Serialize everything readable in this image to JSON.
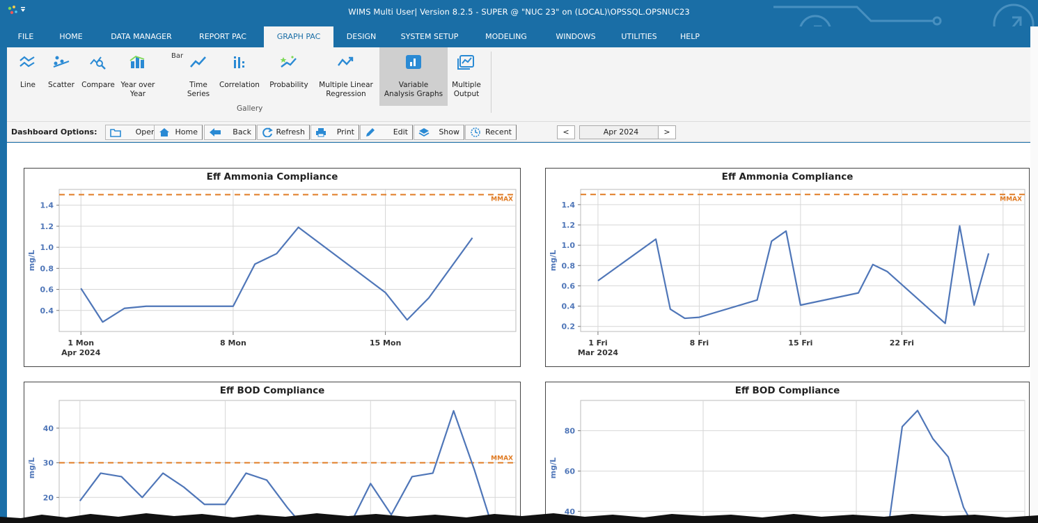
{
  "window": {
    "title": "WIMS Multi User| Version 8.2.5 - SUPER @ \"NUC 23\" on (LOCAL)\\OPSSQL.OPSNUC23"
  },
  "menu": {
    "items": [
      "FILE",
      "HOME",
      "DATA MANAGER",
      "REPORT PAC",
      "GRAPH PAC",
      "DESIGN",
      "SYSTEM SETUP",
      "MODELING",
      "WINDOWS",
      "UTILITIES",
      "HELP"
    ],
    "active": "GRAPH PAC"
  },
  "ribbon": {
    "buttons": [
      {
        "label": "Line",
        "icon": "line-chart-icon"
      },
      {
        "label": "Scatter",
        "icon": "scatter-chart-icon"
      },
      {
        "label": "Compare",
        "icon": "compare-chart-icon"
      },
      {
        "label": "Year over\nYear",
        "icon": "bar-chart-icon"
      },
      {
        "label": "Time\nSeries",
        "icon": "time-series-icon"
      },
      {
        "label": "Correlation",
        "icon": "correlation-icon"
      },
      {
        "label": "Probability",
        "icon": "probability-icon"
      },
      {
        "label": "Multiple Linear\nRegression",
        "icon": "regression-icon"
      },
      {
        "label": "Variable\nAnalysis Graphs",
        "icon": "variable-analysis-icon"
      },
      {
        "label": "Multiple\nOutput",
        "icon": "multiple-output-icon"
      }
    ],
    "bar_label": "Bar",
    "group_label": "Gallery",
    "selected": "Variable\nAnalysis Graphs"
  },
  "dashboard": {
    "label": "Dashboard Options:",
    "buttons": [
      "Open",
      "Home",
      "Back",
      "Refresh",
      "Print",
      "Edit",
      "Show",
      "Recent"
    ],
    "prev": "<",
    "next": ">",
    "month": "Apr 2024"
  },
  "colors": {
    "accent": "#1a6ea6",
    "series": "#4f76b8",
    "mmax": "#e07b23"
  },
  "chart_data": [
    {
      "type": "line",
      "title": "Eff Ammonia Compliance",
      "ylabel": "mg/L",
      "xlabel": "",
      "date_label": "Apr 2024",
      "x_ticks": [
        "1 Mon",
        "8 Mon",
        "15 Mon"
      ],
      "x": [
        1,
        2,
        3,
        4,
        5,
        6,
        7,
        8,
        9,
        10,
        11,
        15,
        16,
        17,
        19
      ],
      "values": [
        0.61,
        0.29,
        0.42,
        0.44,
        0.44,
        0.44,
        0.44,
        0.44,
        0.84,
        0.94,
        1.19,
        0.57,
        0.31,
        0.52,
        1.09
      ],
      "ylim": [
        0.2,
        1.55
      ],
      "y_ticks": [
        0.4,
        0.6,
        0.8,
        1.0,
        1.2,
        1.4
      ],
      "limit": {
        "label": "MMAX",
        "value": 1.5
      }
    },
    {
      "type": "line",
      "title": "Eff Ammonia Compliance",
      "ylabel": "mg/L",
      "xlabel": "",
      "date_label": "Mar 2024",
      "x_ticks": [
        "1 Fri",
        "8 Fri",
        "15 Fri",
        "22 Fri"
      ],
      "x": [
        1,
        5,
        6,
        7,
        8,
        12,
        13,
        14,
        15,
        19,
        20,
        21,
        25,
        26,
        27,
        28
      ],
      "values": [
        0.65,
        1.06,
        0.37,
        0.28,
        0.29,
        0.46,
        1.04,
        1.14,
        0.41,
        0.53,
        0.81,
        0.74,
        0.23,
        1.19,
        0.41,
        0.92
      ],
      "ylim": [
        0.15,
        1.55
      ],
      "y_ticks": [
        0.2,
        0.4,
        0.6,
        0.8,
        1.0,
        1.2,
        1.4
      ],
      "limit": {
        "label": "MMAX",
        "value": 1.5
      }
    },
    {
      "type": "line",
      "title": "Eff BOD Compliance",
      "ylabel": "mg/L",
      "xlabel": "",
      "x": [
        1,
        2,
        3,
        4,
        5,
        6,
        7,
        8,
        9,
        10,
        11,
        12,
        13,
        14,
        15,
        16,
        17,
        18,
        19,
        20,
        21
      ],
      "values": [
        19,
        27,
        26,
        20,
        27,
        23,
        18,
        18,
        27,
        25,
        17,
        10,
        8,
        12,
        24,
        15,
        26,
        27,
        45,
        28,
        9
      ],
      "ylim": [
        9,
        48
      ],
      "y_ticks": [
        10,
        20,
        30,
        40
      ],
      "limit": {
        "label": "MMAX",
        "value": 30
      }
    },
    {
      "type": "line",
      "title": "Eff BOD Compliance",
      "ylabel": "mg/L",
      "xlabel": "",
      "x": [
        1,
        2,
        3,
        4,
        5,
        6,
        7,
        8,
        9,
        10,
        11,
        12,
        13,
        14,
        15,
        16,
        17,
        18,
        19,
        20,
        21,
        22,
        23,
        24,
        25,
        26,
        27,
        28
      ],
      "values": [
        24,
        25,
        23,
        24,
        26,
        25,
        24,
        23,
        25,
        26,
        25,
        28,
        27,
        26,
        25,
        28,
        27,
        26,
        28,
        27,
        82,
        90,
        76,
        67,
        42,
        28,
        26,
        27
      ],
      "ylim": [
        28,
        95
      ],
      "y_ticks": [
        40,
        60,
        80
      ],
      "limit": {
        "label": "MMAX",
        "value": 30
      }
    }
  ]
}
